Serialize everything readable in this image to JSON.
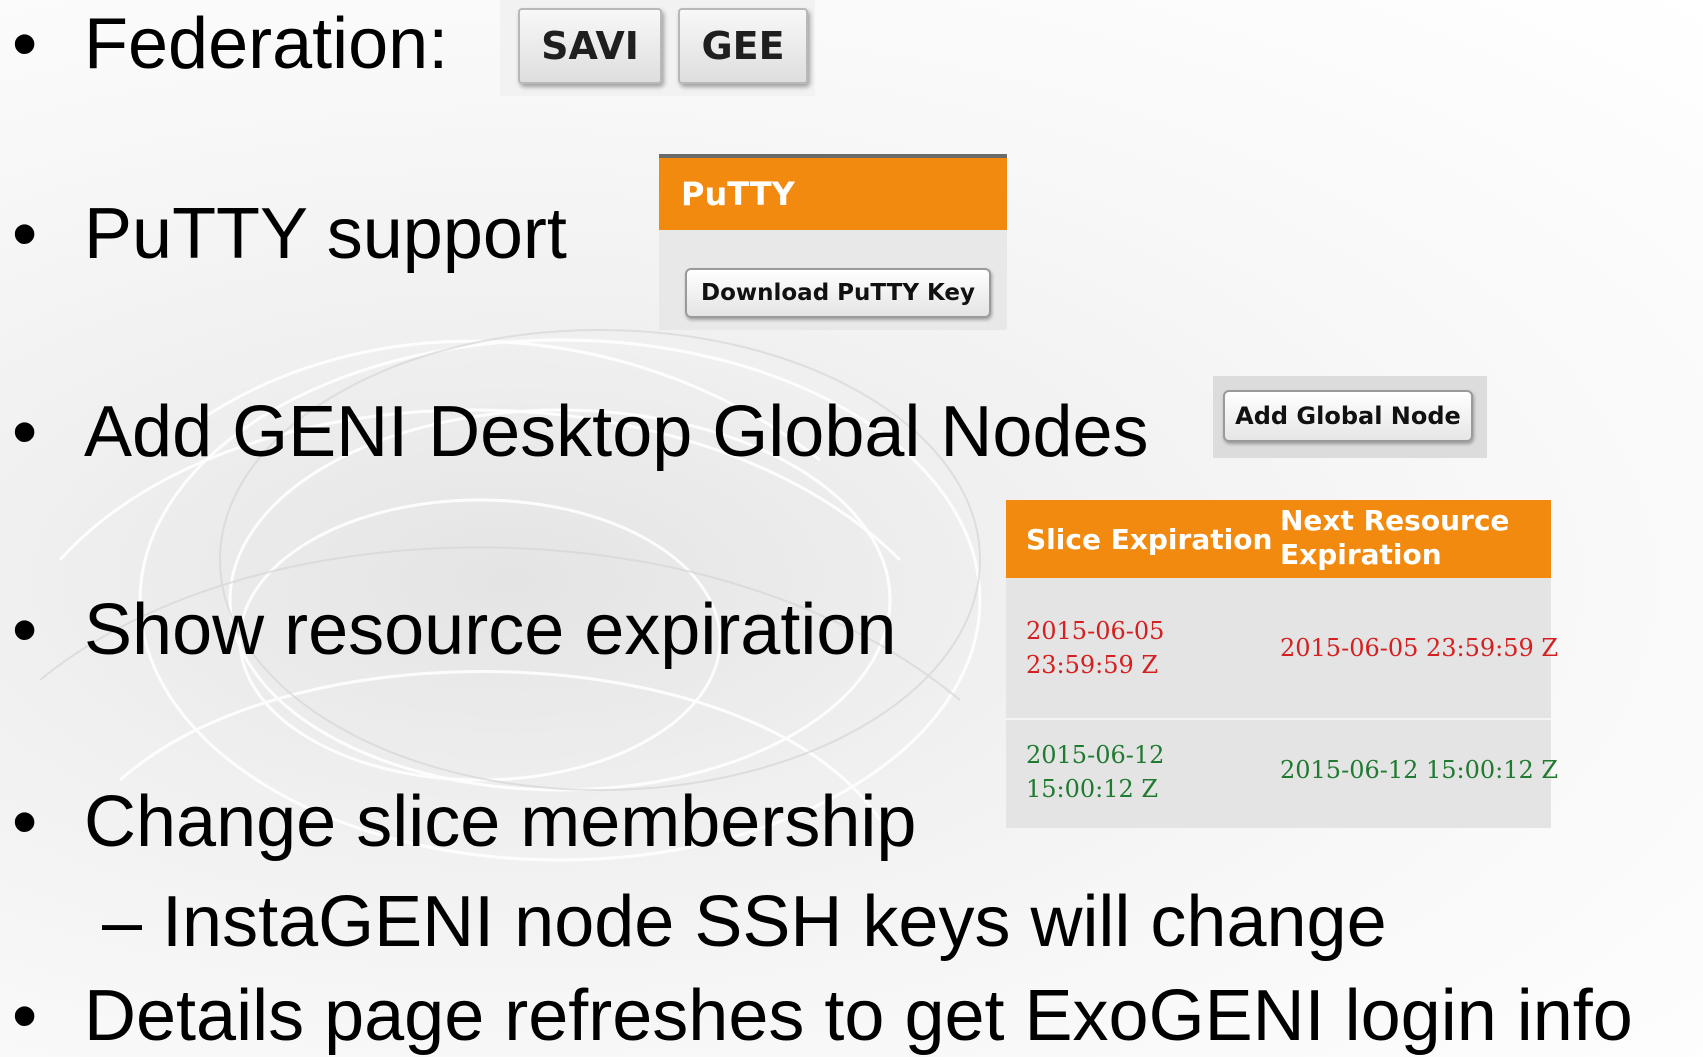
{
  "bullets": {
    "federation": "Federation:",
    "putty": "PuTTY support",
    "global_nodes": "Add GENI Desktop Global Nodes",
    "expiration": "Show resource expiration",
    "membership": "Change slice membership",
    "membership_sub": "– InstaGENI node SSH keys will change",
    "details": "Details page refreshes to get ExoGENI login info"
  },
  "bullet_glyph": "•",
  "federation_buttons": [
    "SAVI",
    "GEE"
  ],
  "putty_panel": {
    "header": "PuTTY",
    "button": "Download PuTTY Key"
  },
  "global_node_button": "Add Global Node",
  "expiration_table": {
    "headers": [
      "Slice Expiration",
      "Next Resource Expiration"
    ],
    "rows": [
      {
        "slice_line1": "2015-06-05",
        "slice_line2": "23:59:59 Z",
        "resource": "2015-06-05 23:59:59 Z",
        "status": "expiring"
      },
      {
        "slice_line1": "2015-06-12",
        "slice_line2": "15:00:12 Z",
        "resource": "2015-06-12 15:00:12 Z",
        "status": "ok"
      }
    ]
  },
  "colors": {
    "accent_orange": "#f28a0f",
    "expiring_red": "#d42020",
    "ok_green": "#207a30"
  }
}
